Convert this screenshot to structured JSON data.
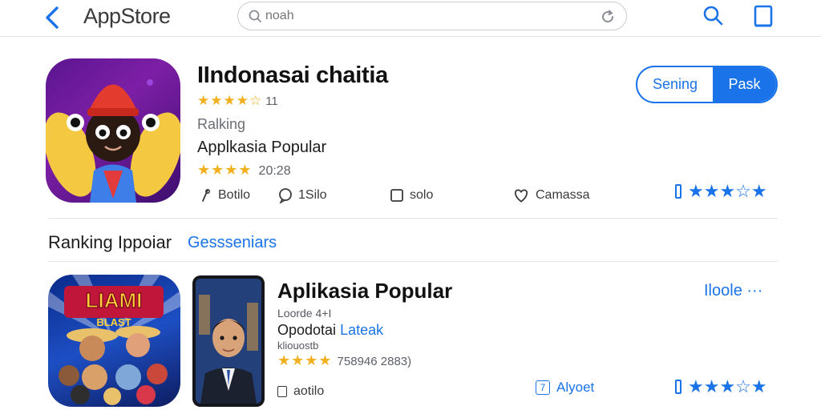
{
  "topbar": {
    "brand": "AppStore",
    "search_placeholder": "noah"
  },
  "hero": {
    "title": "IIndonasai chaitia",
    "stars": "★★★★☆",
    "rating_count": "11",
    "ranking_label": "Ralking",
    "subtitle": "Applkasia Popular",
    "stars2": "★★★★",
    "rating2_count": "20:28",
    "actions": [
      {
        "label": "Botilo",
        "icon": "pin-icon"
      },
      {
        "label": "1Silo",
        "icon": "chat-icon"
      },
      {
        "label": "solo",
        "icon": "square-icon"
      },
      {
        "label": "Camassa",
        "icon": "heart-icon"
      }
    ],
    "pill_left": "Sening",
    "pill_right": "Pask",
    "side_stars": "★★★☆★"
  },
  "section": {
    "title": "Ranking Ippoiar",
    "link": "Gessseniars"
  },
  "app2": {
    "game_banner": "LIAMI",
    "game_banner2": "BLAST",
    "title": "Aplikasia Popular",
    "developer": "Loorde 4+I",
    "subtitle_plain": "Opodotai",
    "subtitle_link": "Lateak",
    "note": "kliouostb",
    "stars": "★★★★",
    "rating_counts": "758946 2883)",
    "open_label": "Iloole ···",
    "action_label": "aotilo",
    "side_label": "Alyoet",
    "side_box": "7",
    "side_stars": "★★★☆★"
  }
}
